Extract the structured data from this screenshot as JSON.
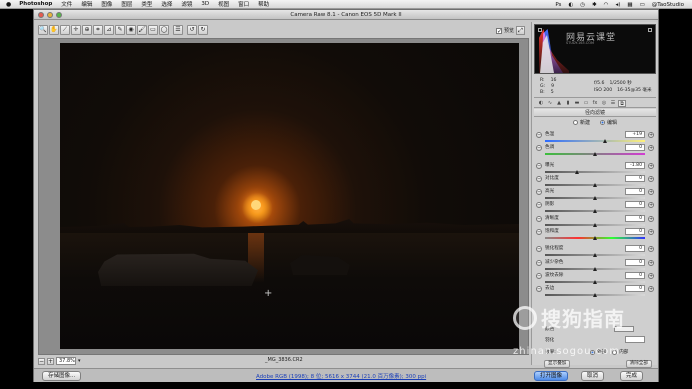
{
  "menubar": {
    "apple_icon": "apple-logo",
    "app_name": "Photoshop",
    "items": [
      "文件",
      "编辑",
      "图像",
      "图层",
      "类型",
      "选择",
      "滤镜",
      "3D",
      "视图",
      "窗口",
      "帮助"
    ],
    "right": {
      "user": "@TaoStudio"
    }
  },
  "window": {
    "title": "Camera Raw 8.1 - Canon EOS 5D Mark II"
  },
  "toolbar": {
    "tools": [
      "zoom-icon",
      "hand-icon",
      "white-balance-icon",
      "color-sampler-icon",
      "target-adjust-icon",
      "crop-icon",
      "straighten-icon",
      "spot-removal-icon",
      "red-eye-icon",
      "adjustment-brush-icon",
      "graduated-filter-icon",
      "radial-filter-icon",
      "preferences-icon",
      "rotate-left-icon",
      "rotate-right-icon"
    ],
    "tool_glyphs": [
      "🔍",
      "✋",
      "⟋",
      "✛",
      "⊕",
      "⌗",
      "⊿",
      "✎",
      "◉",
      "🖌",
      "▭",
      "◯",
      "☰",
      "↺",
      "↻"
    ],
    "preview_label": "预览",
    "preview_checked": true
  },
  "image": {
    "filename": "_MG_3836.CR2",
    "zoom": "37.8%"
  },
  "readout": {
    "r_label": "R:",
    "r": "16",
    "g_label": "G:",
    "g": "9",
    "b_label": "B:",
    "b": "5",
    "aperture": "f/5.6",
    "shutter": "1/2500 秒",
    "iso": "ISO 200",
    "lens": "16-35@35 毫米"
  },
  "panel": {
    "section_title": "径向滤镜",
    "mode_new": "新建",
    "mode_edit": "编辑",
    "mode_selected": "edit",
    "sliders": [
      {
        "label": "色温",
        "value": "+19",
        "pos": 0.6,
        "track": "temp"
      },
      {
        "label": "色调",
        "value": "0",
        "pos": 0.5,
        "track": "tint"
      },
      {
        "label": "曝光",
        "value": "-1.80",
        "pos": 0.32,
        "track": "plain"
      },
      {
        "label": "对比度",
        "value": "0",
        "pos": 0.5,
        "track": "plain"
      },
      {
        "label": "高光",
        "value": "0",
        "pos": 0.5,
        "track": "plain"
      },
      {
        "label": "阴影",
        "value": "0",
        "pos": 0.5,
        "track": "plain"
      },
      {
        "label": "清晰度",
        "value": "0",
        "pos": 0.5,
        "track": "plain"
      },
      {
        "label": "饱和度",
        "value": "0",
        "pos": 0.5,
        "track": "sat"
      },
      {
        "label": "锐化程度",
        "value": "0",
        "pos": 0.5,
        "track": "plain"
      },
      {
        "label": "减少杂色",
        "value": "0",
        "pos": 0.5,
        "track": "plain"
      },
      {
        "label": "波纹去除",
        "value": "0",
        "pos": 0.5,
        "track": "plain"
      },
      {
        "label": "去边",
        "value": "0",
        "pos": 0.5,
        "track": "plain"
      }
    ],
    "color_label": "颜色",
    "feather_label": "羽化",
    "feather_value": "",
    "effect_label": "效果:",
    "effect_outside": "外部",
    "effect_inside": "内部",
    "effect_selected": "outside",
    "show_overlay_label": "显示叠加",
    "clear_all_label": "清除全部"
  },
  "footer": {
    "save_label": "存储图像...",
    "workflow": "Adobe RGB (1998); 8 位; 5616 x 3744 (21.0 百万像素); 300 ppi",
    "open_label": "打开图像",
    "cancel_label": "取消",
    "done_label": "完成"
  },
  "watermark": {
    "main": "搜狗指南",
    "url": "zhinan.sogou.com",
    "brand": "网易云课堂",
    "brand_sub": "STUDY.163.COM"
  },
  "colors": {
    "accent": "#4e8be6",
    "window_bg": "#c9c9c9",
    "canvas_bg": "#8c8c8c"
  }
}
